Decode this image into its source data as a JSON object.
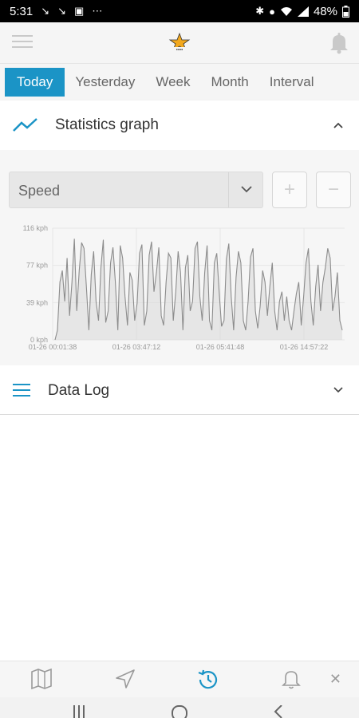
{
  "status_bar": {
    "time": "5:31",
    "battery": "48%"
  },
  "tabs": [
    {
      "label": "Today",
      "active": true
    },
    {
      "label": "Yesterday",
      "active": false
    },
    {
      "label": "Week",
      "active": false
    },
    {
      "label": "Month",
      "active": false
    },
    {
      "label": "Interval",
      "active": false
    }
  ],
  "stats_section": {
    "title": "Statistics graph",
    "metric_select": "Speed",
    "zoom_in": "+",
    "zoom_out": "−"
  },
  "data_log_section": {
    "title": "Data Log"
  },
  "colors": {
    "accent": "#1b94c6",
    "series": "#8c8c8c"
  },
  "chart_data": {
    "type": "line",
    "y_ticks": [
      "116 kph",
      "77 kph",
      "39 kph",
      "0 kph"
    ],
    "x_ticks": [
      "01-26 00:01:38",
      "01-26 03:47:12",
      "01-26 05:41:48",
      "01-26 14:57:22"
    ],
    "ylim": [
      0,
      116
    ],
    "y_unit": "kph",
    "grid": true,
    "series": [
      {
        "values": [
          0,
          10,
          60,
          72,
          40,
          85,
          25,
          60,
          105,
          30,
          72,
          101,
          95,
          55,
          10,
          68,
          92,
          40,
          20,
          75,
          104,
          18,
          30,
          80,
          96,
          60,
          10,
          98,
          85,
          45,
          15,
          70,
          62,
          20,
          38,
          90,
          99,
          15,
          30,
          88,
          102,
          50,
          70,
          96,
          25,
          15,
          60,
          90,
          85,
          20,
          50,
          92,
          70,
          10,
          75,
          88,
          30,
          40,
          95,
          102,
          45,
          20,
          70,
          98,
          20,
          10,
          80,
          90,
          50,
          14,
          20,
          84,
          100,
          45,
          10,
          65,
          92,
          80,
          20,
          10,
          40,
          86,
          95,
          30,
          12,
          35,
          72,
          60,
          25,
          55,
          80,
          30,
          10,
          40,
          50,
          20,
          45,
          20,
          10,
          30,
          48,
          60,
          15,
          45,
          80,
          95,
          40,
          15,
          55,
          78,
          30,
          60,
          75,
          95,
          85,
          30,
          45,
          70,
          20,
          10
        ]
      }
    ]
  }
}
